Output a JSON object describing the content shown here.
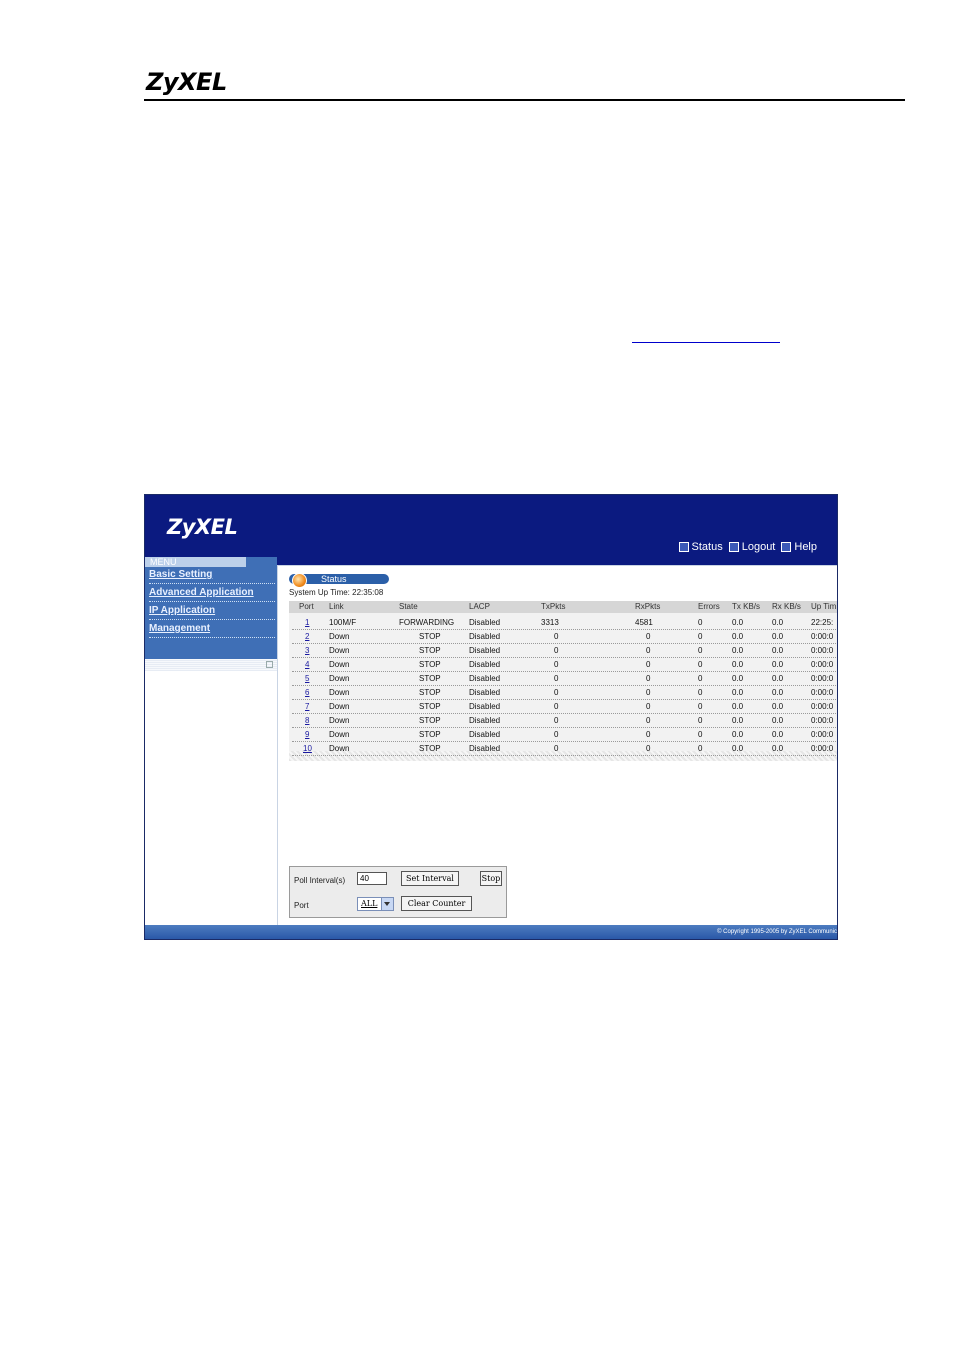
{
  "document": {
    "brand": "ZyXEL"
  },
  "app": {
    "logo": "ZyXEL",
    "topnav": [
      {
        "label": "Status"
      },
      {
        "label": "Logout"
      },
      {
        "label": "Help"
      }
    ]
  },
  "sidebar": {
    "menu_label": "MENU",
    "items": [
      {
        "label": "Basic Setting"
      },
      {
        "label": "Advanced Application"
      },
      {
        "label": "IP Application"
      },
      {
        "label": "Management"
      }
    ]
  },
  "status": {
    "title": "Status",
    "uptime": "System Up Time: 22:35:08"
  },
  "table": {
    "headers": [
      "Port",
      "Link",
      "State",
      "LACP",
      "TxPkts",
      "RxPkts",
      "Errors",
      "Tx KB/s",
      "Rx KB/s",
      "Up Tim"
    ],
    "rows": [
      [
        "1",
        "100M/F",
        "FORWARDING",
        "Disabled",
        "3313",
        "4581",
        "0",
        "0.0",
        "0.0",
        "22:25:"
      ],
      [
        "2",
        "Down",
        "STOP",
        "Disabled",
        "0",
        "0",
        "0",
        "0.0",
        "0.0",
        "0:00:0"
      ],
      [
        "3",
        "Down",
        "STOP",
        "Disabled",
        "0",
        "0",
        "0",
        "0.0",
        "0.0",
        "0:00:0"
      ],
      [
        "4",
        "Down",
        "STOP",
        "Disabled",
        "0",
        "0",
        "0",
        "0.0",
        "0.0",
        "0:00:0"
      ],
      [
        "5",
        "Down",
        "STOP",
        "Disabled",
        "0",
        "0",
        "0",
        "0.0",
        "0.0",
        "0:00:0"
      ],
      [
        "6",
        "Down",
        "STOP",
        "Disabled",
        "0",
        "0",
        "0",
        "0.0",
        "0.0",
        "0:00:0"
      ],
      [
        "7",
        "Down",
        "STOP",
        "Disabled",
        "0",
        "0",
        "0",
        "0.0",
        "0.0",
        "0:00:0"
      ],
      [
        "8",
        "Down",
        "STOP",
        "Disabled",
        "0",
        "0",
        "0",
        "0.0",
        "0.0",
        "0:00:0"
      ],
      [
        "9",
        "Down",
        "STOP",
        "Disabled",
        "0",
        "0",
        "0",
        "0.0",
        "0.0",
        "0:00:0"
      ],
      [
        "10",
        "Down",
        "STOP",
        "Disabled",
        "0",
        "0",
        "0",
        "0.0",
        "0.0",
        "0:00:0"
      ]
    ]
  },
  "controls": {
    "poll_label": "Poll Interval(s)",
    "poll_value": "40",
    "set_interval_label": "Set Interval",
    "stop_label": "Stop",
    "port_label": "Port",
    "port_selected": "ALL",
    "clear_counter_label": "Clear Counter"
  },
  "footer": {
    "copyright": "© Copyright 1995-2005 by ZyXEL Communic"
  },
  "colors": {
    "header_bg": "#0b1a80",
    "sidebar_bg": "#3f6fb6",
    "footer_bg": "#2a58a8"
  }
}
